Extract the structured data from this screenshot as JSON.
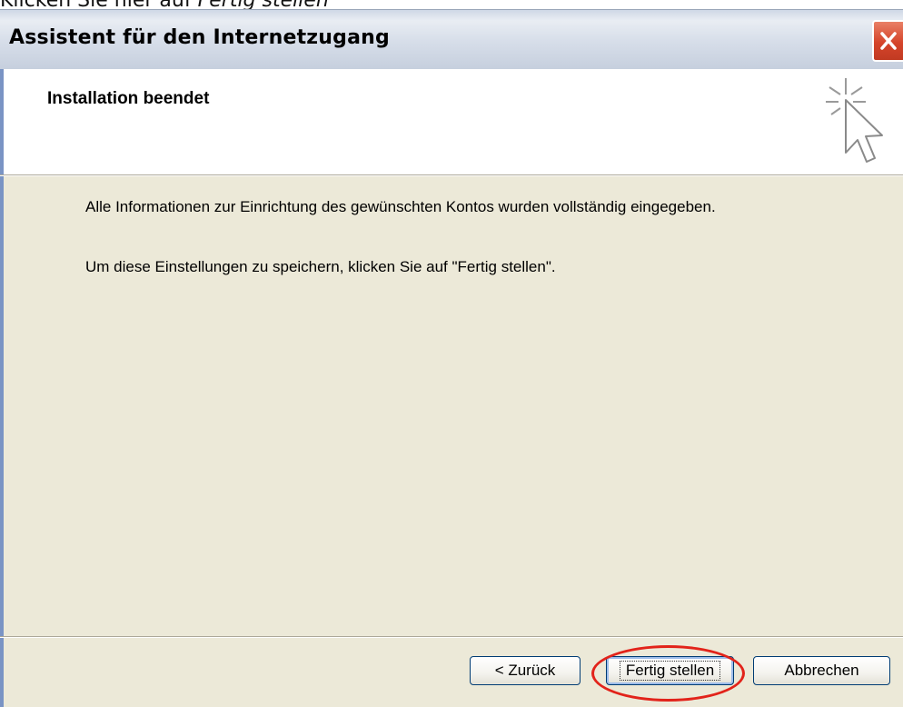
{
  "caption": {
    "prefix": "Klicken Sie hier auf ",
    "emphasis": "Fertig stellen"
  },
  "window": {
    "title": "Assistent für den Internetzugang",
    "close_icon": "close-icon"
  },
  "header": {
    "title": "Installation beendet",
    "icon": "wizard-cursor-icon"
  },
  "content": {
    "paragraph1": "Alle Informationen zur Einrichtung des gewünschten Kontos wurden vollständig eingegeben.",
    "paragraph2": "Um diese Einstellungen zu speichern, klicken Sie auf \"Fertig stellen\"."
  },
  "buttons": {
    "back": "< Zurück",
    "finish": "Fertig stellen",
    "cancel": "Abbrechen"
  },
  "colors": {
    "highlight": "#e2231a",
    "close_button": "#d5442a",
    "dialog_background": "#ece9d8"
  }
}
